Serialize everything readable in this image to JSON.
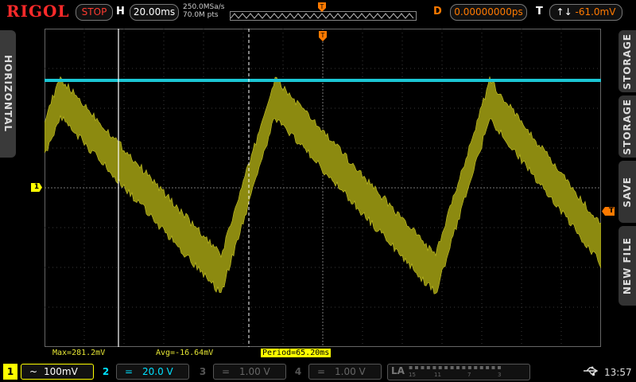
{
  "brand": "RIGOL",
  "status": "STOP",
  "horizontal": {
    "label": "H",
    "timebase": "20.00ms",
    "sample_rate": "250.0MSa/s",
    "memory_depth": "70.0M pts"
  },
  "delay": {
    "label": "D",
    "value": "0.00000000ps"
  },
  "trigger": {
    "label": "T",
    "icon": "↑↓",
    "level": "-61.0mV",
    "marker": "T"
  },
  "left_menu": {
    "label": "HORIZONTAL"
  },
  "right_menu": {
    "items": [
      "STORAGE",
      "STORAGE",
      "SAVE",
      "NEW FILE"
    ]
  },
  "channel_marker": "1",
  "measurements": {
    "max": "Max=281.2mV",
    "avg": "Avg=-16.64mV",
    "period": "Period=65.20ms"
  },
  "channels": [
    {
      "num": "1",
      "coupling": "~",
      "scale": "100mV",
      "color": "#ffff00"
    },
    {
      "num": "2",
      "coupling": "=",
      "scale": "20.0 V",
      "color": "#00e0ff"
    },
    {
      "num": "3",
      "coupling": "=",
      "scale": "1.00 V",
      "color": "#666666"
    },
    {
      "num": "4",
      "coupling": "=",
      "scale": "1.00 V",
      "color": "#666666"
    }
  ],
  "la": {
    "label": "LA",
    "ticks": [
      "15",
      "11",
      "7",
      "3"
    ]
  },
  "clock": "13:57",
  "icons": {
    "usb": "usb-icon",
    "trigger_marker": "trigger-position-icon"
  },
  "colors": {
    "ch1": "#ffff00",
    "ch2": "#00e0ff",
    "accent": "#ff7a00",
    "stop": "#ff3b30"
  }
}
